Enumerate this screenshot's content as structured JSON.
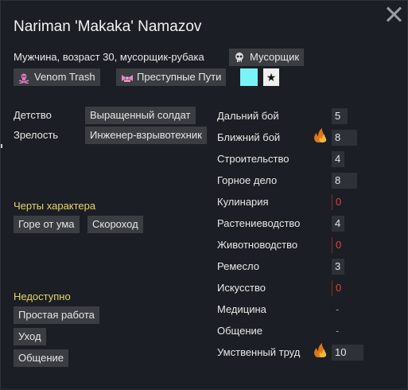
{
  "title": "Nariman 'Makaka' Namazov",
  "subtitle": "Мужчина, возраст 30, мусорщик-рубака",
  "factions": [
    {
      "label": "Мусорщик",
      "icon": "skull-icon"
    },
    {
      "label": "Venom Trash",
      "icon": "pink-skull-icon"
    },
    {
      "label": "Преступные Пути",
      "icon": "pink-bow-icon"
    }
  ],
  "favorite_color": "#79f2f8",
  "badge_glyph": "★",
  "backstory": {
    "childhood_label": "Детство",
    "childhood_value": "Выращенный солдат",
    "adulthood_label": "Зрелость",
    "adulthood_value": "Инженер-взрывотехник"
  },
  "traits": {
    "title": "Черты характера",
    "items": [
      "Горе от ума",
      "Скороход"
    ]
  },
  "incapable": {
    "title": "Недоступно",
    "items": [
      "Простая работа",
      "Уход",
      "Общение"
    ]
  },
  "skills": [
    {
      "name": "Дальний бой",
      "value": "5",
      "passion": false
    },
    {
      "name": "Ближний бой",
      "value": "8",
      "passion": true
    },
    {
      "name": "Строительство",
      "value": "4",
      "passion": false
    },
    {
      "name": "Горное дело",
      "value": "8",
      "passion": false
    },
    {
      "name": "Кулинария",
      "value": "0",
      "passion": false
    },
    {
      "name": "Растениеводство",
      "value": "4",
      "passion": false
    },
    {
      "name": "Животноводство",
      "value": "0",
      "passion": false
    },
    {
      "name": "Ремесло",
      "value": "3",
      "passion": false
    },
    {
      "name": "Искусство",
      "value": "0",
      "passion": false
    },
    {
      "name": "Медицина",
      "value": "-",
      "passion": false
    },
    {
      "name": "Общение",
      "value": "-",
      "passion": false
    },
    {
      "name": "Умственный труд",
      "value": "10",
      "passion": true
    }
  ],
  "skill_levels": [
    5,
    8,
    4,
    8,
    0,
    4,
    0,
    3,
    0,
    null,
    null,
    10
  ],
  "colors": {
    "section_title": "#e8d66a",
    "zero_skill": "#d9483a",
    "passion_flame": "#f0a020"
  }
}
